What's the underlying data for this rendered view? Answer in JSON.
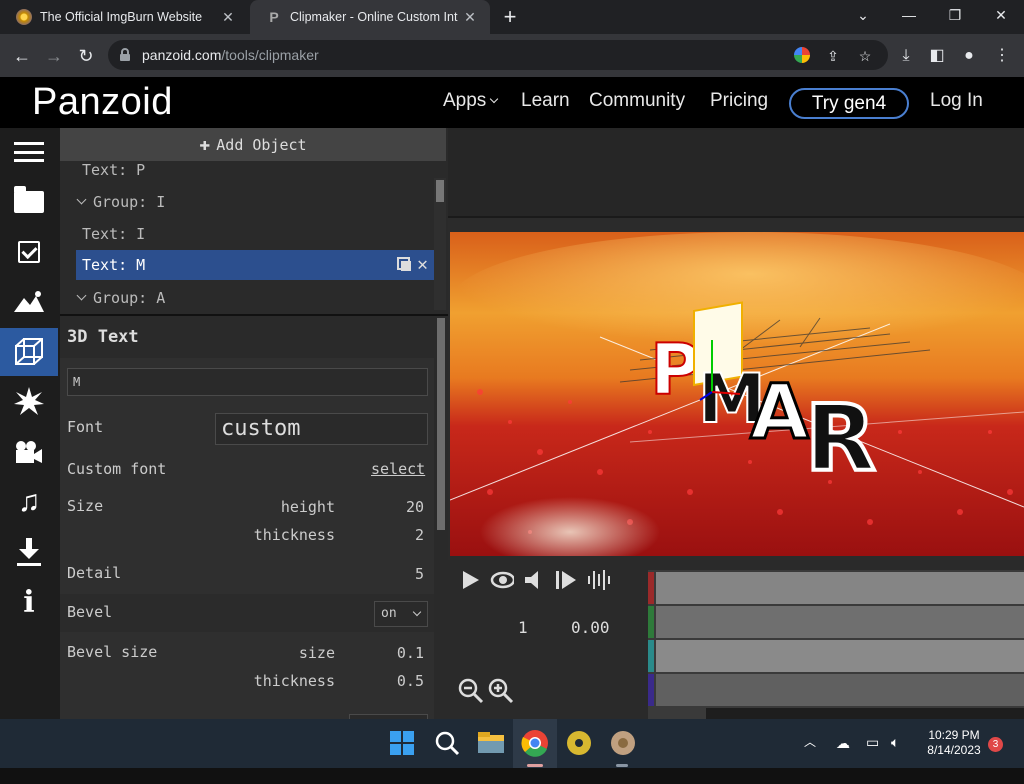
{
  "browser": {
    "tabs": [
      {
        "title": "The Official ImgBurn Website"
      },
      {
        "title": "Clipmaker - Online Custom Intro..."
      }
    ],
    "url_host": "panzoid.com",
    "url_path": "/tools/clipmaker"
  },
  "site": {
    "logo": "Panzoid",
    "nav": {
      "apps": "Apps",
      "learn": "Learn",
      "community": "Community",
      "pricing": "Pricing",
      "try": "Try gen4",
      "login": "Log In"
    }
  },
  "objects": {
    "add_label": "Add Object",
    "items": [
      {
        "label": "Text: P"
      },
      {
        "label": "Group: I"
      },
      {
        "label": "Text: I"
      },
      {
        "label": "Text: M"
      },
      {
        "label": "Group: A"
      }
    ]
  },
  "props": {
    "title": "3D Text",
    "text_value": "M",
    "font_label": "Font",
    "font_value": "custom",
    "custom_font_label": "Custom font",
    "custom_font_link": "select",
    "size_label": "Size",
    "height_label": "height",
    "height_value": "20",
    "thickness_label": "thickness",
    "thickness_value": "2",
    "detail_label": "Detail",
    "detail_value": "5",
    "bevel_label": "Bevel",
    "bevel_value": "on",
    "bevel_size_label": "Bevel size",
    "bevel_size_sub": "size",
    "bevel_size_value": "0.1",
    "bevel_thickness_label": "thickness",
    "bevel_thickness_value": "0.5"
  },
  "timeline": {
    "frame": "1",
    "time": "0.00",
    "track_colors": [
      "#9b2a2a",
      "#2e7a3a",
      "#2a8a8a",
      "#3a2a8a"
    ]
  },
  "taskbar": {
    "time": "10:29 PM",
    "date": "8/14/2023",
    "notifications": "3"
  },
  "preview": {
    "text": "PIMAR"
  }
}
